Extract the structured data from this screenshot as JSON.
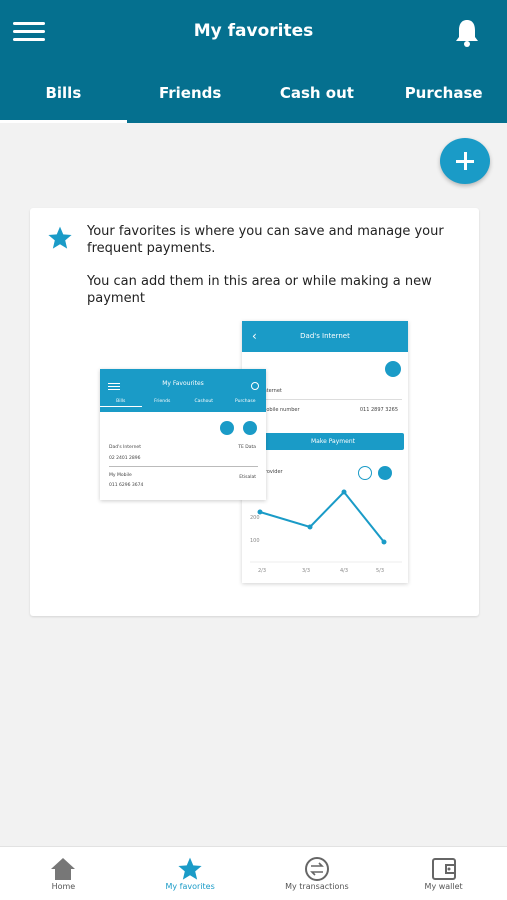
{
  "header": {
    "title": "My favorites",
    "tabs": [
      {
        "label": "Bills",
        "active": true
      },
      {
        "label": "Friends",
        "active": false
      },
      {
        "label": "Cash out",
        "active": false
      },
      {
        "label": "Purchase",
        "active": false
      }
    ]
  },
  "card": {
    "paragraph1": "Your favorites is where you can save and manage your frequent payments.",
    "paragraph2": "You can add them in this area or while making a new payment"
  },
  "illustration": {
    "back": {
      "title": "Dad's Internet",
      "row1": "Internet",
      "row2_label": "Mobile number",
      "row2_value": "011 2897 3265",
      "button": "Make Payment",
      "chart_label": "Provider",
      "y_ticks": [
        "300",
        "200",
        "100"
      ],
      "x_ticks": [
        "2/3",
        "3/3",
        "4/3",
        "5/3"
      ]
    },
    "front": {
      "title": "My Favourites",
      "tabs": [
        "Bills",
        "Friends",
        "Cashout",
        "Purchase"
      ],
      "item1_name": "Dad's Internet",
      "item1_provider": "TE Data",
      "item1_number": "02 2401 2896",
      "item2_name": "My Mobile",
      "item2_provider": "Etisalat",
      "item2_number": "011 6296 3674"
    }
  },
  "bottom_nav": [
    {
      "label": "Home",
      "icon": "home-icon"
    },
    {
      "label": "My favorites",
      "icon": "star-icon",
      "active": true
    },
    {
      "label": "My transactions",
      "icon": "transfer-icon"
    },
    {
      "label": "My wallet",
      "icon": "wallet-icon"
    }
  ],
  "colors": {
    "header": "#05708f",
    "accent": "#1a9bc7",
    "background": "#f2f2f2"
  }
}
